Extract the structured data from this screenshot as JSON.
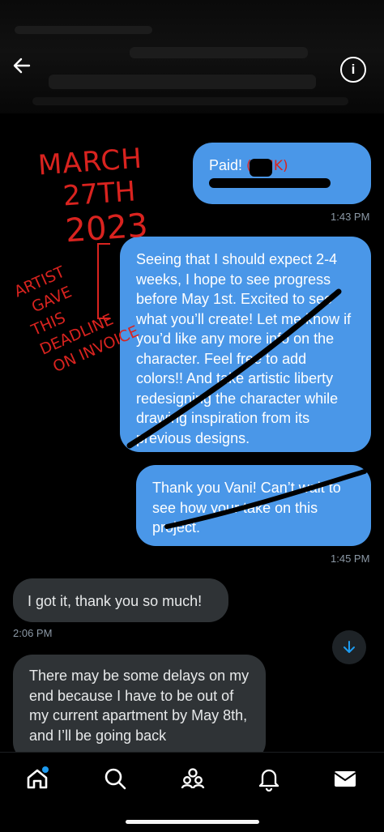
{
  "header": {
    "back_icon": "arrow-left-icon",
    "info_icon": "info-icon"
  },
  "messages": [
    {
      "side": "out",
      "text": "Paid! ",
      "redacted_link_annotation": "(LINK)"
    },
    {
      "side": "out",
      "time": "1:43 PM",
      "text": "Seeing that I should expect 2-4 weeks, I hope to see progress before May 1st. Excited to see what you’ll create! Let me know if you’d like any more info on the character. Feel free to add colors!! And take artistic liberty redesigning the character while drawing inspiration from its previous designs."
    },
    {
      "side": "out",
      "time": "1:45 PM",
      "text": "Thank you Vani! Can’t wait to see how your take on this project."
    },
    {
      "side": "in",
      "time": "2:06 PM",
      "text": "I got it, thank you so much!"
    },
    {
      "side": "in",
      "text": "There may be some delays on my end because I have to be out of my current apartment by May 8th, and I’ll be going back"
    }
  ],
  "annotations": {
    "date_line1": "MARCH",
    "date_line2": "27TH",
    "date_line3": "2023",
    "note_line1": "ARTIST",
    "note_line2": "GAVE",
    "note_line3": "THIS",
    "note_line4": "DEADLINE",
    "note_line5": "ON INVOICE"
  },
  "tabbar": [
    {
      "name": "home-icon"
    },
    {
      "name": "search-icon"
    },
    {
      "name": "communities-icon"
    },
    {
      "name": "bell-icon"
    },
    {
      "name": "mail-icon"
    }
  ],
  "colors": {
    "outgoing": "#4a97e8",
    "incoming": "#2f3336",
    "annotation": "#d9231f"
  }
}
